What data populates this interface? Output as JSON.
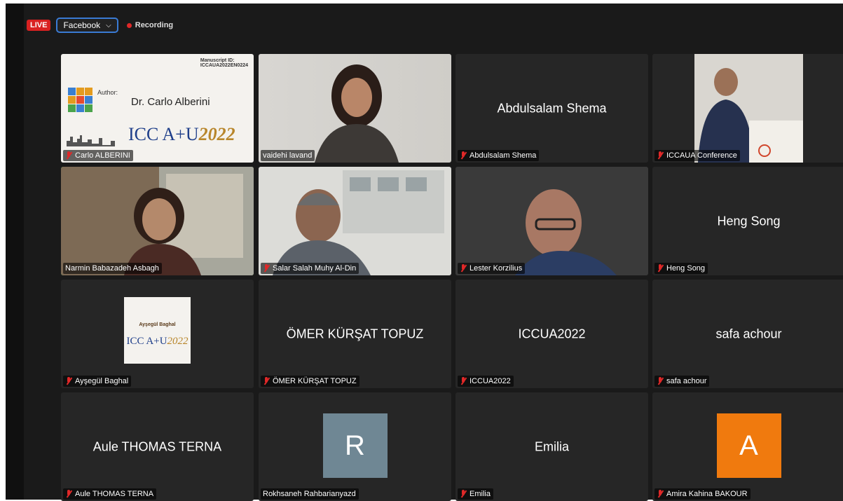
{
  "topbar": {
    "live_label": "LIVE",
    "stream_target": "Facebook",
    "recording_label": "Recording"
  },
  "colors": {
    "live": "#d92121",
    "active_speaker_border": "#23d160",
    "tile_bg": "#262626",
    "muted_icon": "#e02828"
  },
  "participants": [
    {
      "name": "Carlo ALBERINI",
      "muted": true,
      "video": "slide"
    },
    {
      "name": "vaidehi lavand",
      "muted": false,
      "video": "camera"
    },
    {
      "name": "Abdulsalam Shema",
      "display": "Abdulsalam Shema",
      "muted": true,
      "video": "off"
    },
    {
      "name": "ICCAUA Conference",
      "muted": true,
      "video": "camera"
    },
    {
      "name": "Narmin Babazadeh Asbagh",
      "muted": false,
      "video": "camera",
      "active_speaker": true
    },
    {
      "name": "Salar Salah Muhy Al-Din",
      "muted": true,
      "video": "camera"
    },
    {
      "name": "Lester Korzilius",
      "muted": true,
      "video": "camera"
    },
    {
      "name": "Heng Song",
      "display": "Heng Song",
      "muted": true,
      "video": "off"
    },
    {
      "name": "Ayşegül Baghal",
      "muted": true,
      "video": "slide"
    },
    {
      "name": "ÖMER KÜRŞAT TOPUZ",
      "display": "ÖMER KÜRŞAT TOPUZ",
      "muted": true,
      "video": "off"
    },
    {
      "name": "ICCUA2022",
      "display": "ICCUA2022",
      "muted": true,
      "video": "off"
    },
    {
      "name": "safa achour",
      "display": "safa achour",
      "muted": true,
      "video": "off"
    },
    {
      "name": "Aule THOMAS TERNA",
      "display": "Aule THOMAS TERNA",
      "muted": true,
      "video": "off"
    },
    {
      "name": "Rokhsaneh Rahbarianyazd",
      "avatar": "R",
      "avatar_color": "#6f8794",
      "muted": false,
      "video": "off"
    },
    {
      "name": "Emilia",
      "display": "Emilia",
      "muted": true,
      "video": "off"
    },
    {
      "name": "Amira Kahina BAKOUR",
      "avatar": "A",
      "avatar_color": "#f07a0e",
      "muted": true,
      "video": "off"
    }
  ],
  "slides": {
    "carlo": {
      "code_line1": "Manuscript ID:",
      "code_line2": "ICCAUA2022EN0224",
      "author_label": "Author:",
      "author_name": "Dr. Carlo Alberini",
      "conf_main": "ICC A+U",
      "conf_year": "2022"
    },
    "aysegul": {
      "author_name": "Ayşegül Baghal",
      "conf_main": "ICC A+U",
      "conf_year": "2022"
    }
  }
}
